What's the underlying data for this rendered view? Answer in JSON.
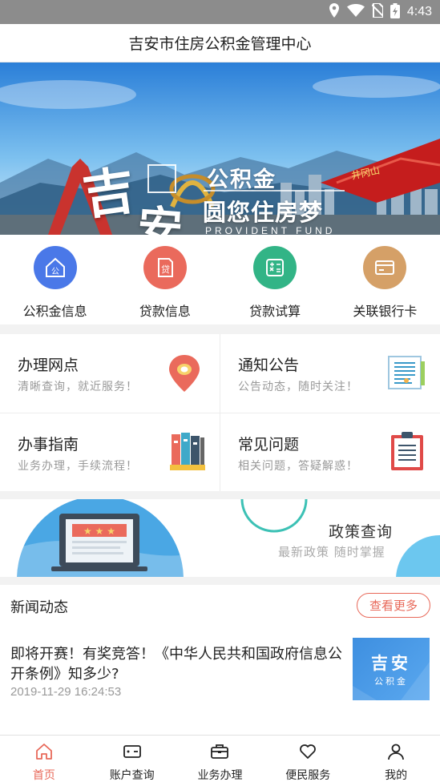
{
  "status_bar": {
    "time": "4:43"
  },
  "header": {
    "title": "吉安市住房公积金管理中心"
  },
  "banner": {
    "big_char_1": "吉",
    "big_char_2": "安",
    "slogan_1": "公积金",
    "slogan_2": "圆您住房梦",
    "slogan_en": "PROVIDENT FUND",
    "flag_text": "井冈山"
  },
  "quick_items": [
    {
      "label": "公积金信息",
      "icon": "house-icon",
      "color": "#4a78e8",
      "glyph": "公"
    },
    {
      "label": "贷款信息",
      "icon": "loan-doc-icon",
      "color": "#ea6a5c",
      "glyph": "贷"
    },
    {
      "label": "贷款试算",
      "icon": "calculator-icon",
      "color": "#32b486",
      "glyph": ""
    },
    {
      "label": "关联银行卡",
      "icon": "bank-card-icon",
      "color": "#d5a067",
      "glyph": ""
    }
  ],
  "service_cards": [
    {
      "title": "办理网点",
      "subtitle": "清晰查询，就近服务！",
      "icon": "map-pin-icon"
    },
    {
      "title": "通知公告",
      "subtitle": "公告动态，随时关注！",
      "icon": "notice-board-icon"
    },
    {
      "title": "办事指南",
      "subtitle": "业务办理，手续流程！",
      "icon": "binders-icon"
    },
    {
      "title": "常见问题",
      "subtitle": "相关问题，答疑解惑！",
      "icon": "clipboard-icon"
    }
  ],
  "policy": {
    "title": "政策查询",
    "subtitle": "最新政策 随时掌握"
  },
  "news": {
    "heading": "新闻动态",
    "more_label": "查看更多",
    "items": [
      {
        "title": "即将开赛！有奖竞答！《中华人民共和国政府信息公开条例》知多少?",
        "time": "2019-11-29 16:24:53",
        "thumb_big": "吉安",
        "thumb_small": "公积金"
      }
    ]
  },
  "bottom_nav": [
    {
      "label": "首页",
      "icon": "home-icon",
      "active": true
    },
    {
      "label": "账户查询",
      "icon": "wallet-icon",
      "active": false
    },
    {
      "label": "业务办理",
      "icon": "briefcase-icon",
      "active": false
    },
    {
      "label": "便民服务",
      "icon": "heart-icon",
      "active": false
    },
    {
      "label": "我的",
      "icon": "person-icon",
      "active": false
    }
  ],
  "colors": {
    "accent": "#e8695a",
    "status_bar": "#8c8c8c"
  }
}
